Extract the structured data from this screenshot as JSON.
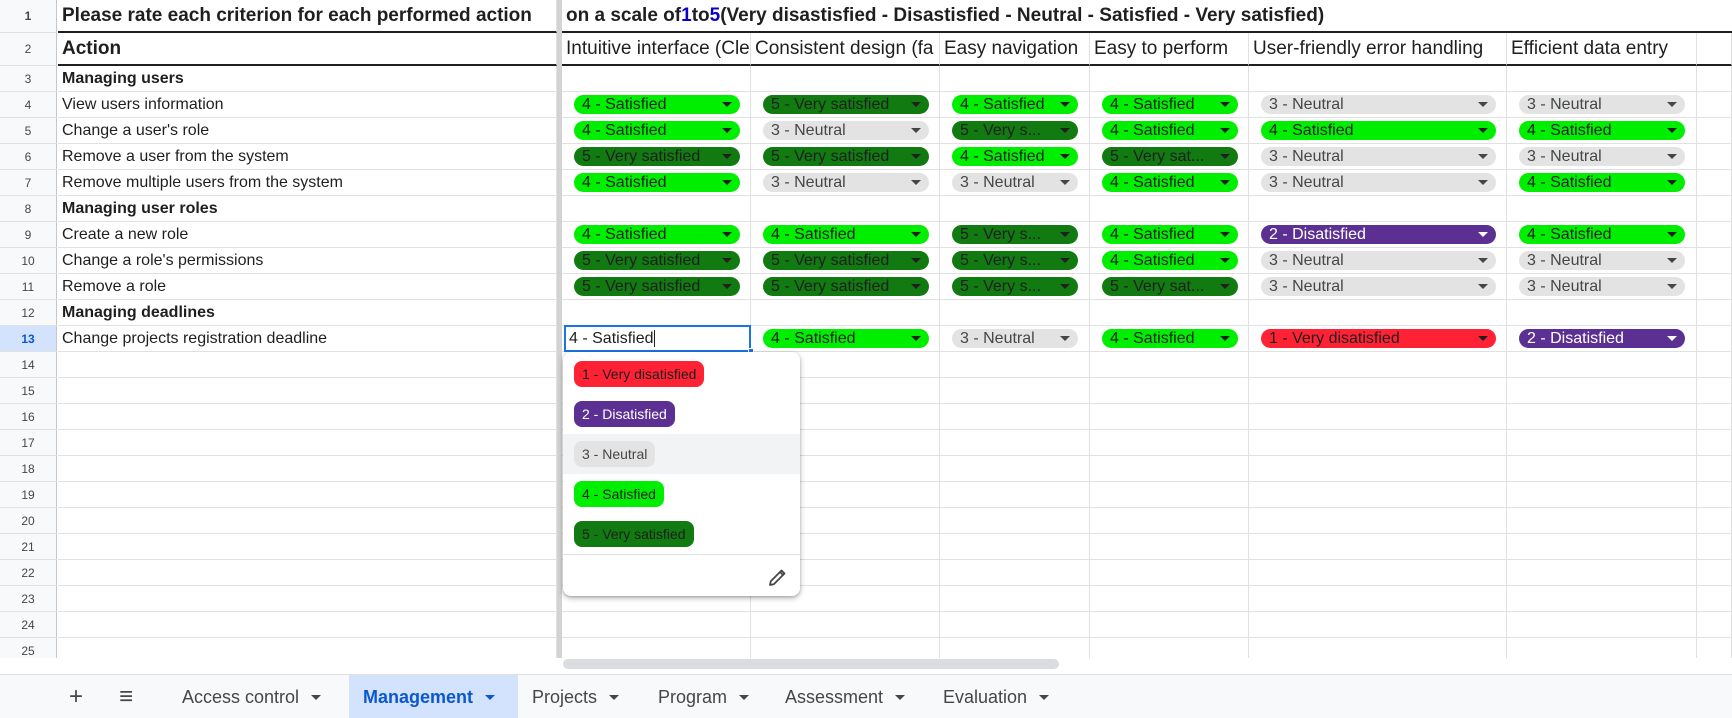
{
  "sheet": {
    "title_row": {
      "left": "Please rate each criterion for each performed action",
      "right_pre": "on a scale of ",
      "num1": "1",
      "mid": " to ",
      "num2": "5",
      "right_post": " (Very disastisfied - Disastisfied - Neutral - Satisfied - Very satisfied)"
    },
    "header_row": {
      "action": "Action",
      "columns": [
        "Intuitive interface (Cle",
        "Consistent design (fa",
        "Easy navigation",
        "Easy to perform",
        "User-friendly error handling",
        "Efficient data entry"
      ]
    },
    "row_numbers": [
      "1",
      "2",
      "3",
      "4",
      "5",
      "6",
      "7",
      "8",
      "9",
      "10",
      "11",
      "12",
      "13",
      "14",
      "15",
      "16",
      "17",
      "18",
      "19",
      "20",
      "21",
      "22",
      "23",
      "24",
      "25"
    ],
    "sections": {
      "users": "Managing users",
      "roles": "Managing user roles",
      "deadlines": "Managing deadlines"
    },
    "rows": [
      {
        "action": "View users information",
        "ratings": [
          "4 - Satisfied",
          "5 - Very satisfied",
          "4 - Satisfied",
          "4 - Satisfied",
          "3 - Neutral",
          "3 - Neutral"
        ]
      },
      {
        "action": "Change a user's role",
        "ratings": [
          "4 - Satisfied",
          "3 - Neutral",
          "5 - Very s...",
          "4 - Satisfied",
          "4 - Satisfied",
          "4 - Satisfied"
        ]
      },
      {
        "action": "Remove a user from the system",
        "ratings": [
          "5 - Very satisfied",
          "5 - Very satisfied",
          "4 - Satisfied",
          "5 - Very sat...",
          "3 - Neutral",
          "3 - Neutral"
        ]
      },
      {
        "action": "Remove multiple users from the system",
        "ratings": [
          "4 - Satisfied",
          "3 - Neutral",
          "3 - Neutral",
          "4 - Satisfied",
          "3 - Neutral",
          "4 - Satisfied"
        ]
      },
      {
        "action": "Create a new role",
        "ratings": [
          "4 - Satisfied",
          "4 - Satisfied",
          "5 - Very s...",
          "4 - Satisfied",
          "2 - Disatisfied",
          "4 - Satisfied"
        ]
      },
      {
        "action": "Change a role's permissions",
        "ratings": [
          "5 - Very satisfied",
          "5 - Very satisfied",
          "5 - Very s...",
          "4 - Satisfied",
          "3 - Neutral",
          "3 - Neutral"
        ]
      },
      {
        "action": "Remove a role",
        "ratings": [
          "5 - Very satisfied",
          "5 - Very satisfied",
          "5 - Very s...",
          "5 - Very sat...",
          "3 - Neutral",
          "3 - Neutral"
        ]
      },
      {
        "action": "Change projects registration deadline",
        "ratings": [
          "4 - Satisfied",
          "4 - Satisfied",
          "3 - Neutral",
          "4 - Satisfied",
          "1 - Very disatisfied",
          "2 - Disatisfied"
        ]
      }
    ],
    "editing_value": "4 - Satisfied"
  },
  "dropdown": {
    "options": [
      "1 - Very disatisfied",
      "2 - Disatisfied",
      "3 - Neutral",
      "4 - Satisfied",
      "5 - Very satisfied"
    ],
    "hovered": "3 - Neutral",
    "edit_icon": "pencil-icon"
  },
  "colors": {
    "very_disatisfied": "#ff2234",
    "disatisfied": "#5b3092",
    "neutral": "#e3e3e3",
    "satisfied": "#00ee00",
    "very_satisfied": "#117a11",
    "selection": "#1a73e8",
    "active_tab": "#d3e3fd"
  },
  "tabbar": {
    "add_icon": "+",
    "menu_icon": "≡",
    "tabs": [
      "Access control",
      "Management",
      "Projects",
      "Program",
      "Assessment",
      "Evaluation"
    ],
    "active_tab": "Management"
  }
}
